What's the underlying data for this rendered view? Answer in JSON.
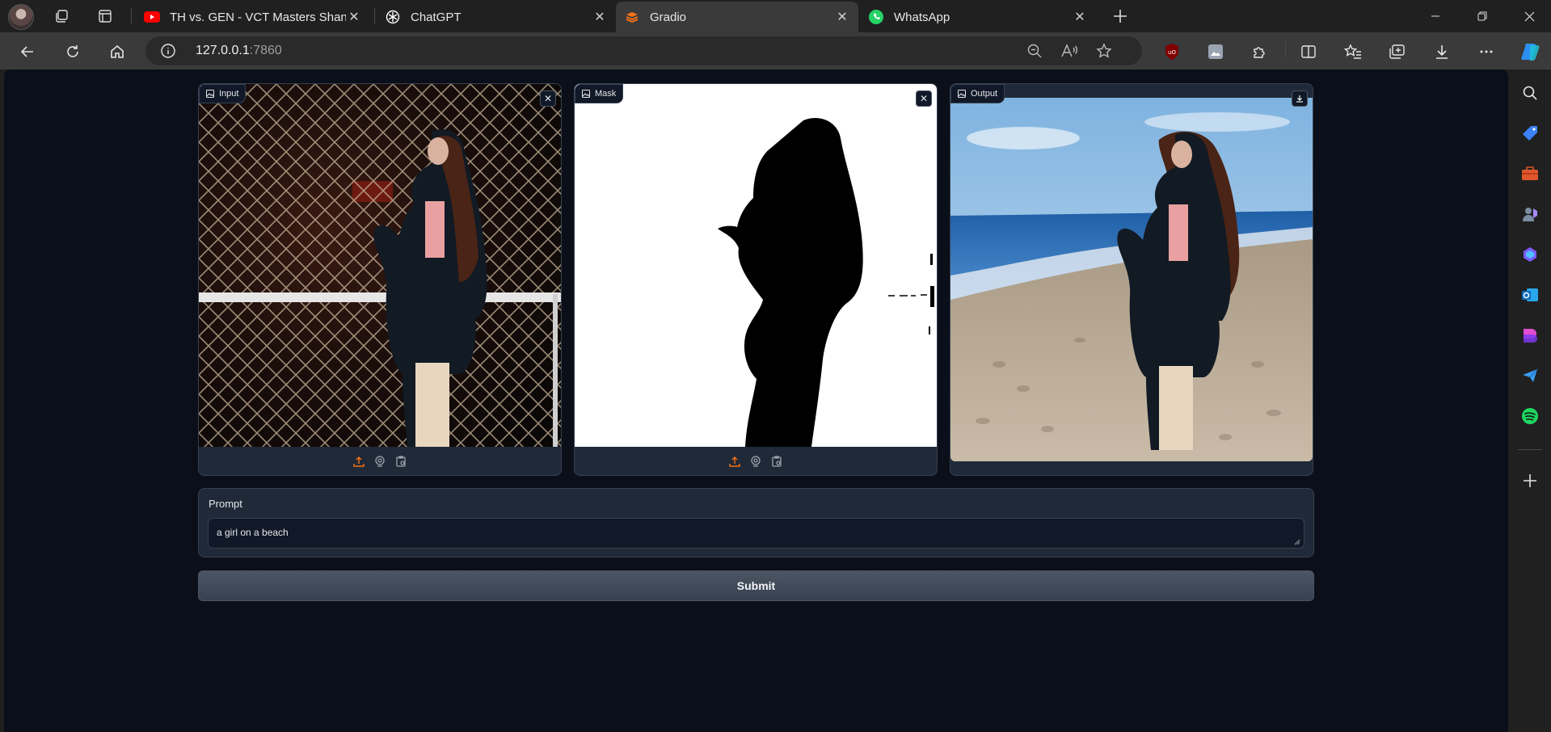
{
  "browser": {
    "tabs": [
      {
        "title": "TH vs. GEN - VCT Masters Shangh",
        "favicon": "youtube-icon",
        "active": false
      },
      {
        "title": "ChatGPT",
        "favicon": "chatgpt-icon",
        "active": false
      },
      {
        "title": "Gradio",
        "favicon": "gradio-icon",
        "active": true
      },
      {
        "title": "WhatsApp",
        "favicon": "whatsapp-icon",
        "active": false
      }
    ],
    "address": {
      "host": "127.0.0.1",
      "port": ":7860"
    },
    "colors": {
      "frame": "#202020",
      "toolbar": "#3a3a3a",
      "page_bg": "#0b0f19",
      "block_bg": "#1f2937",
      "accent_orange": "#f97316"
    }
  },
  "app": {
    "panels": {
      "input": {
        "label": "Input",
        "close": "✕"
      },
      "mask": {
        "label": "Mask",
        "close": "✕"
      },
      "output": {
        "label": "Output"
      }
    },
    "prompt": {
      "label": "Prompt",
      "value": "a girl on a beach"
    },
    "submit_label": "Submit"
  }
}
